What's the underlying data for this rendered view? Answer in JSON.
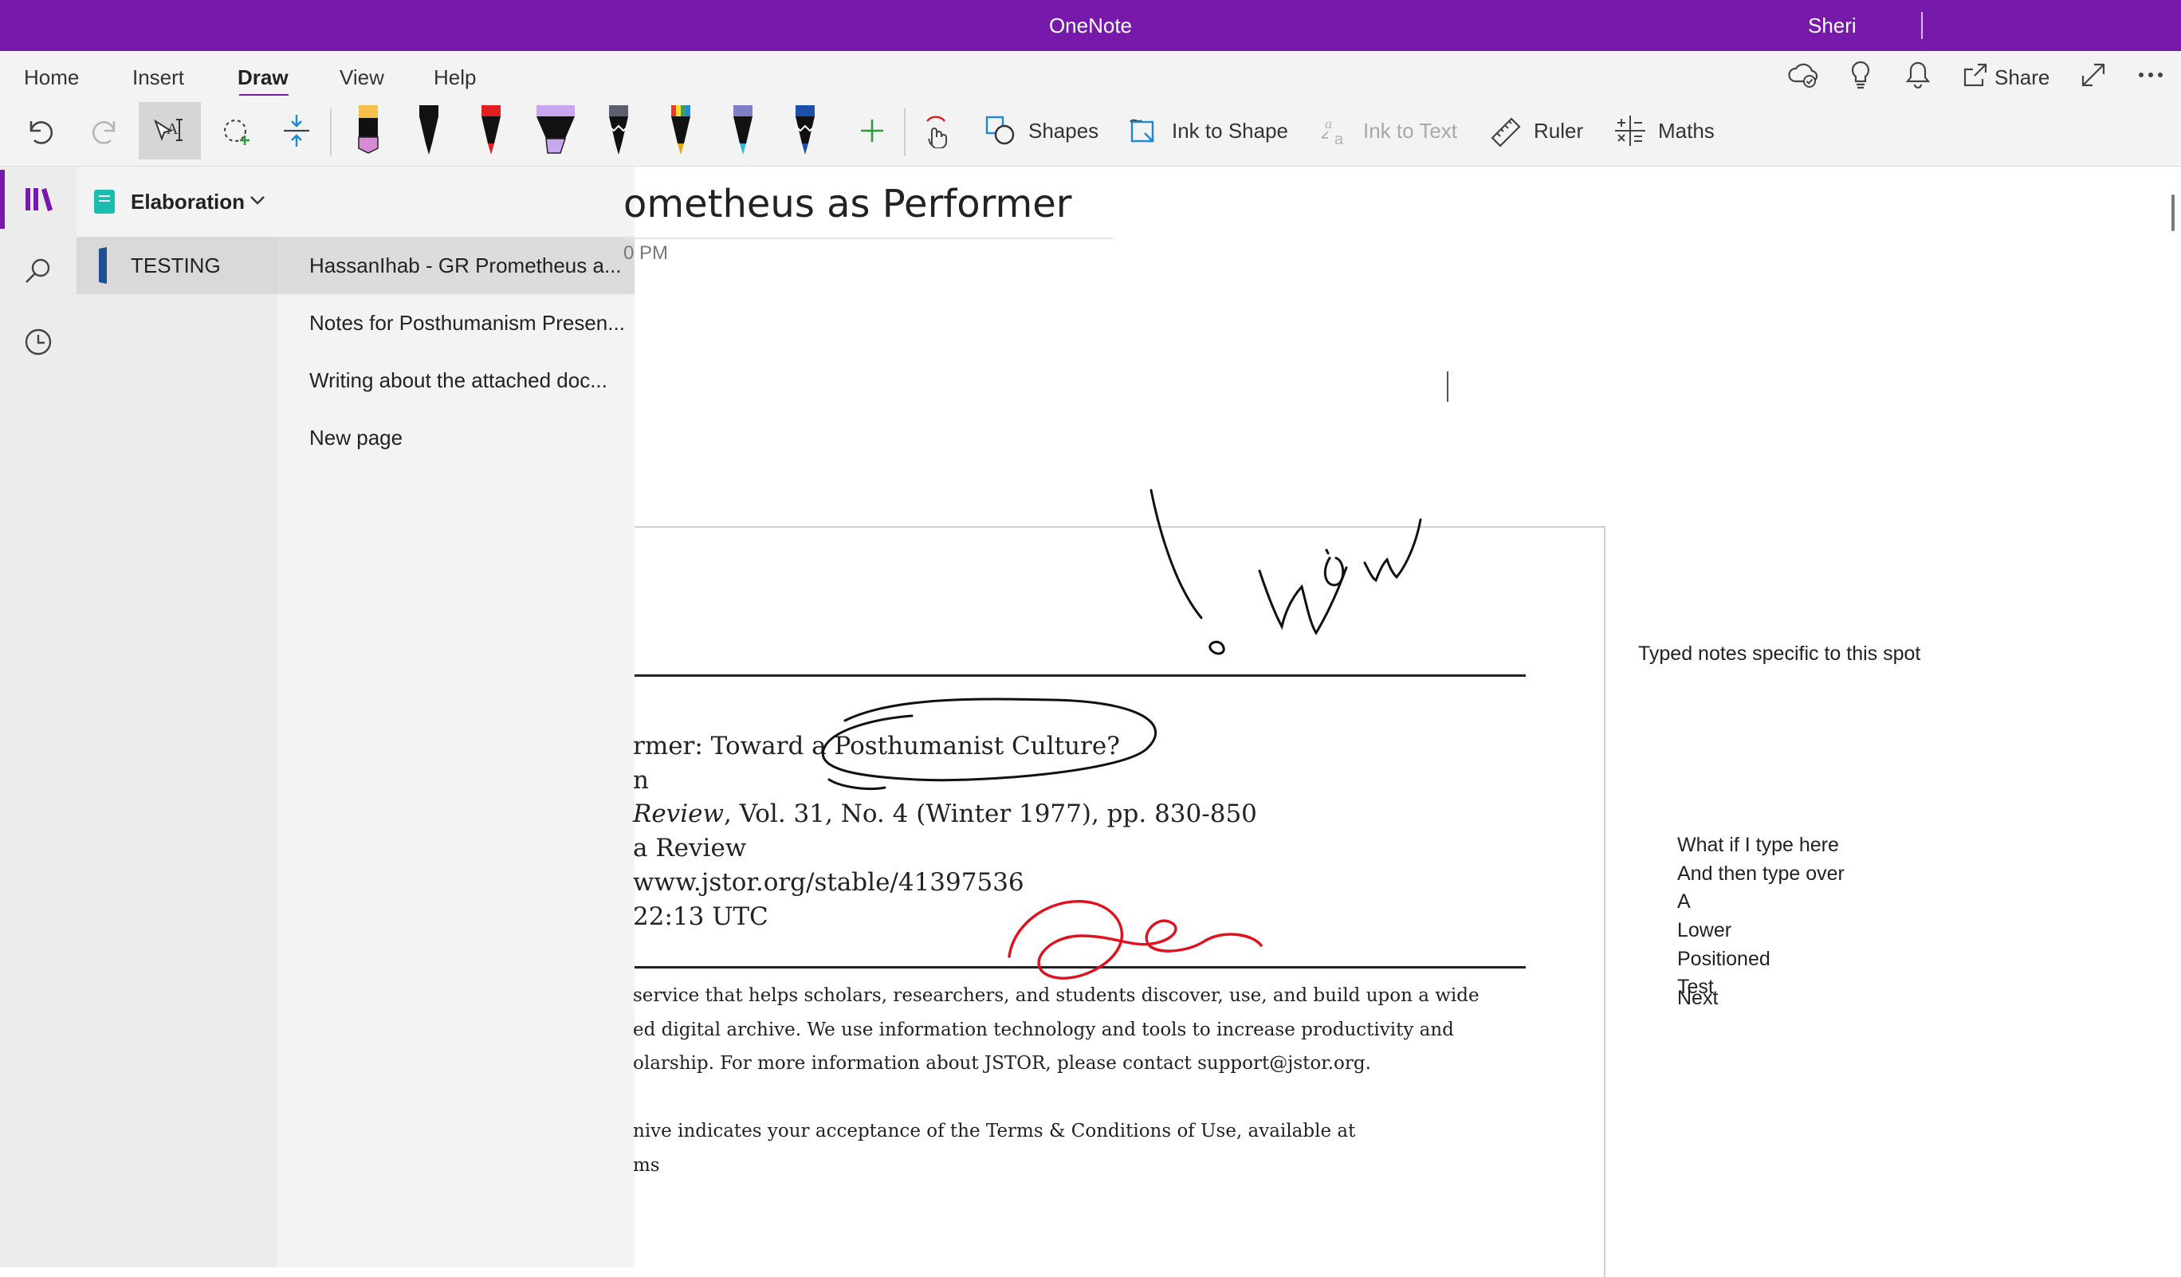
{
  "window": {
    "title": "OneNote",
    "user": "Sheri",
    "back_icon": "arrow-left-icon",
    "forward_icon": "arrow-right-icon",
    "accent_color": "#7719aa"
  },
  "menu": {
    "tabs": [
      {
        "label": "Home"
      },
      {
        "label": "Insert"
      },
      {
        "label": "Draw",
        "active": true
      },
      {
        "label": "View"
      },
      {
        "label": "Help"
      }
    ],
    "share_label": "Share"
  },
  "toolbar": {
    "shapes_label": "Shapes",
    "ink_to_shape_label": "Ink to Shape",
    "ink_to_text_label": "Ink to Text",
    "ruler_label": "Ruler",
    "maths_label": "Maths",
    "pens": [
      {
        "name": "highlighter-yellow",
        "color": "#f5c04a"
      },
      {
        "name": "pen-black",
        "color": "#111111"
      },
      {
        "name": "pen-red",
        "color": "#e02020"
      },
      {
        "name": "highlighter-lavender",
        "color": "#c9a6f0"
      },
      {
        "name": "pencil-galaxy",
        "color": "#5a6070"
      },
      {
        "name": "pen-rainbow",
        "color": "#e6a817"
      },
      {
        "name": "pen-ocean",
        "color": "#35b8d8"
      },
      {
        "name": "pen-navy",
        "color": "#1e4fa8"
      }
    ]
  },
  "sidebar": {
    "notebook": "Elaboration",
    "sections": [
      {
        "label": "TESTING"
      }
    ],
    "pages": [
      {
        "label": "HassanIhab - GR Prometheus a...",
        "active": true
      },
      {
        "label": "Notes for Posthumanism Presen..."
      },
      {
        "label": "Writing about the attached doc..."
      },
      {
        "label": "New page"
      }
    ]
  },
  "page": {
    "title": "ometheus as Performer",
    "date": "0 PM"
  },
  "document": {
    "lines": [
      "rmer: Toward a Posthumanist Culture?",
      "n",
      "Review",
      ", Vol. 31, No. 4 (Winter 1977), pp. 830-850",
      "a Review",
      "www.jstor.org/stable/41397536",
      " 22:13 UTC"
    ],
    "small_lines": [
      "service that helps scholars, researchers, and students discover, use, and build upon a wide",
      "ed digital archive. We use information technology and tools to increase productivity and",
      "olarship. For more information about JSTOR, please contact support@jstor.org.",
      "nive indicates your acceptance of the Terms & Conditions of Use, available at",
      "ms"
    ]
  },
  "notes": {
    "typed_spot": "Typed notes specific to this spot",
    "lines": [
      "What if I type here",
      "And then type over",
      "A",
      "Lower",
      "Positioned",
      "Test"
    ],
    "overlap": "Next"
  },
  "ink": {
    "black_color": "#111111",
    "red_color": "#e0101e"
  }
}
